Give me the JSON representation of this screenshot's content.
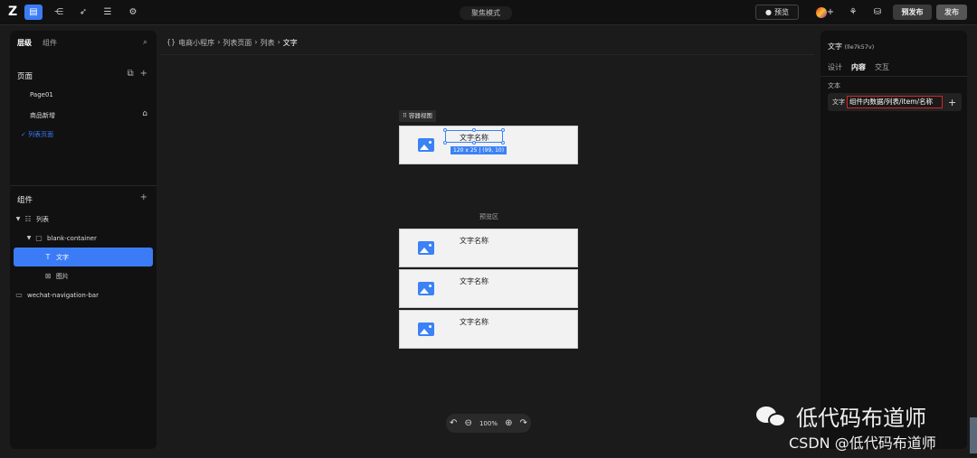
{
  "topbar": {
    "logo": "Z",
    "center_title": "聚焦模式",
    "preview_label": "预览",
    "prepublish_label": "预发布",
    "publish_label": "发布"
  },
  "left_panel": {
    "tabs": [
      "层级",
      "组件"
    ],
    "pages_title": "页面",
    "pages": [
      "Page01",
      "商品新增",
      "列表页面"
    ],
    "components_title": "组件",
    "tree": [
      {
        "label": "列表"
      },
      {
        "label": "blank-container"
      },
      {
        "label": "文字"
      },
      {
        "label": "图片"
      },
      {
        "label": "wechat-navigation-bar"
      }
    ]
  },
  "canvas": {
    "breadcrumb": [
      "电商小程序",
      "列表页面",
      "列表",
      "文字"
    ],
    "container_tag": "容器视图",
    "item_text": "文字名称",
    "size_tag": "120 x 25 | (99, 10)",
    "preview_label": "预览区",
    "zoom": "100%"
  },
  "right_panel": {
    "title": "文字",
    "id": "(lle7k57v)",
    "tabs": [
      "设计",
      "内容",
      "交互"
    ],
    "section": "文本",
    "field_label": "文字",
    "field_value": "组件内数据/列表/item/名称"
  },
  "watermark": {
    "main": "低代码布道师",
    "sub": "CSDN @低代码布道师"
  },
  "colors": {
    "accent": "#3b7cf6",
    "highlight_border": "#d42525",
    "panel_bg": "#111111",
    "canvas_bg": "#1b1b1b"
  }
}
